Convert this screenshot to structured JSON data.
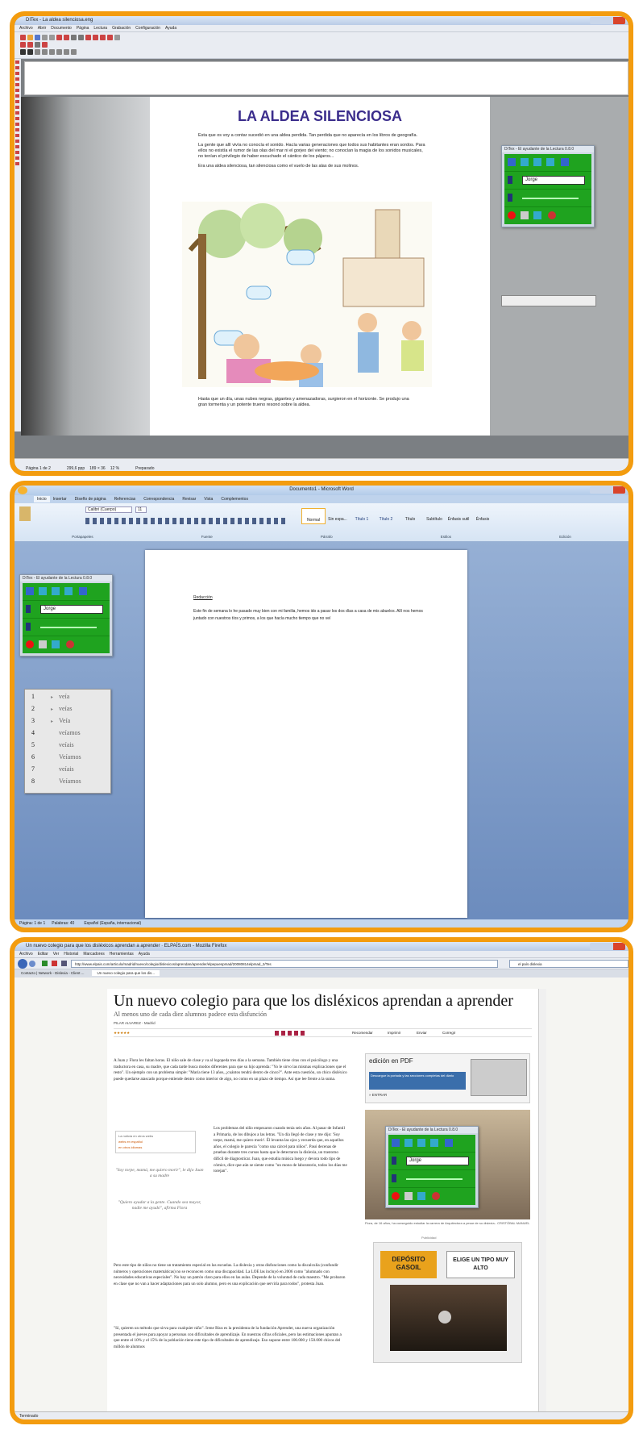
{
  "panel1": {
    "window_title": "DITex - La aldea silenciosa.eng",
    "menu": [
      "Archivo",
      "Abrir",
      "Documento",
      "Página",
      "Lectura",
      "Grabación",
      "Configuración",
      "Ayuda"
    ],
    "doc_title": "LA ALDEA SILENCIOSA",
    "doc_paragraphs": [
      "Esta que os voy a contar sucedió en una aldea perdida. Tan perdida que no aparecía en los libros de geografía.",
      "La gente que allí vivía no conocía el sonido. Hacía varias generaciones que todos sus habitantes eran sordos. Para ellos no existía el rumor de las olas del mar ni el gorjeo del viento; no conocían la magia de los sonidos musicales, no tenían el privilegio de haber escuchado el cántico de los pájaros...",
      "Era una aldea silenciosa, tan silenciosa como el vuelo de las alas de sus molinos."
    ],
    "doc_footer": "Hasta que un día, unas nubes negras, gigantes y amenazadoras, surgieron en el horizonte. Se produjo una gran tormenta y un potente trueno resonó sobre la aldea.",
    "status": [
      "Página 1 de 2",
      "299,6 ppp",
      "189 × 36",
      "12 %",
      "Preparado"
    ]
  },
  "reader": {
    "title": "DiTex - El ayudante de la Lectura 0.8.0",
    "voice": "Jorge"
  },
  "panel2": {
    "window_title": "Documento1 - Microsoft Word",
    "tabs": [
      "Inicio",
      "Insertar",
      "Diseño de página",
      "Referencias",
      "Correspondencia",
      "Revisar",
      "Vista",
      "Complementos"
    ],
    "font": "Calibri (Cuerpo)",
    "size": "11",
    "styles": [
      "Normal",
      "Sin espa...",
      "Título 1",
      "Título 2",
      "Título",
      "Subtítulo",
      "Énfasis sutil",
      "Énfasis"
    ],
    "groups": [
      "Portapapeles",
      "Fuente",
      "Párrafo",
      "Estilos",
      "Edición"
    ],
    "doc_heading": "Redacción",
    "doc_text": "Este fin de semana lo he pasado muy bien con mi familia, hemos ido a pasar los dos días a casa de mis abuelos. Allí nos hemos juntado con nuestros tíos y primos, a los que hacía mucho tiempo que no veí",
    "suggestions": [
      {
        "n": "1",
        "w": "veía"
      },
      {
        "n": "2",
        "w": "veías"
      },
      {
        "n": "3",
        "w": "Veía"
      },
      {
        "n": "4",
        "w": "veíamos"
      },
      {
        "n": "5",
        "w": "veíais"
      },
      {
        "n": "6",
        "w": "Veíamos"
      },
      {
        "n": "7",
        "w": "veíais"
      },
      {
        "n": "8",
        "w": "Veíamos"
      }
    ],
    "status": [
      "Página: 1 de 1",
      "Palabras: 40",
      "Español (España, internacional)"
    ]
  },
  "panel3": {
    "window_title": "Un nuevo colegio para que los disléxicos aprendan a aprender · ELPAÍS.com - Mozilla Firefox",
    "menu": [
      "Archivo",
      "Editar",
      "Ver",
      "Historial",
      "Marcadores",
      "Herramientas",
      "Ayuda"
    ],
    "url": "http://www.elpais.com/articulo/madrid/nuevo/colegio/dislexicos/aprendan/aprender/elpepuespmad/20080814elpmad_2/Tes",
    "search": "el país dislexia",
    "tabs": [
      "Contacto | Network - Dislexia - Client ...",
      "Un nuevo colegio para que los dis..."
    ],
    "headline": "Un nuevo colegio para que los disléxicos aprendan a aprender",
    "subhead": "Al menos uno de cada diez alumnos padece esta disfunción",
    "byline": "PILAR ALVAREZ - Madrid",
    "para1": "A Juan y Flora les faltan horas. El niño sale de clase y va al logopeda tres días a la semana. También tiene citas con el psicólogo y una traductora en casa, su madre, que cada tarde busca modos diferentes para que su hijo aprenda: \"Yo le sirvo las mismas explicaciones que el resto\". Un ejemplo con un problema simple: \"María tiene 13 años, ¿cuántos tendrá dentro de cinco?\". Ante esta cuestión, un chico disléxico puede quedarse atascado porque entiende dentro como interior de algo, no como en un plazo de tiempo. Así que lee frente a la suma.",
    "para2": "Los problemas del niño empezaron cuando tenía seis años. Al pasar de Infantil a Primaria, de los dibujos a las letras. \"Un día llegó de clase y me dijo: 'Soy torpe, mamá, me quiero morir'. Él levanta las ojos y recuerda que, en aquellos años, el colegio le parecía \"como una cárcel para niños\". Pasó decenas de pruebas durante tres cursos hasta que le detectaron la dislexia, un trastorno difícil de diagnosticar. Juan, que estudia música luego y devora todo tipo de cómics, dice que aún se siente como \"un mono de laboratorio, todos los días me torejan\".",
    "quote1": "\"Soy torpe, mamá, me quiero morir\", le dijo Juan a su madre",
    "quote2": "\"Quiero ayudar a la gente. Cuando sea mayor, nadie me ayudó\", afirma Flora",
    "side_box": [
      "La noticia en otros webs",
      "webs en español",
      "en otros idiomas"
    ],
    "para3": "Pero este tipo de niños no tiene un tratamiento especial en las escuelas. La dislexia y otras disfunciones como la discalculia (confundir números y operaciones matemáticas) no se reconocen como una discapacidad. La LOE las incluyó en 2006 como \"alumnado con necesidades educativas especiales\". No hay un patrón claro para ellos en las aulas. Depende de la voluntad de cada maestro. \"Me probaron en clase que no van a hacer adaptaciones para un solo alumno, pero es una explicación que serviría para todos\", protesta Juan.",
    "para4": "\"Sí, quieren un método que sirva para cualquier niño\". Irene Rius es la presidenta de la fundación Aprender, una nueva organización presentada el jueves para apoyar a personas con dificultades de aprendizaje. En nuestras cifras oficiales, pero las estimaciones apuntan a que entre el 10% y el 15% de la población tiene este tipo de dificultades de aprendizaje. Eso supone entre 100.000 y 150.000 chicos del millón de alumnos",
    "pdf_box": {
      "title": "edición en PDF",
      "text": "Descargue la portada y las secciones completas del diario",
      "link": "» ENTRAR"
    },
    "photo_caption": "Flora, de 16 años, ha conseguido estudiar la carrera de Arquitectura a pesar de su dislexia.- CRISTÓBAL MANUEL",
    "ad_label": "Publicidad",
    "ad_left": "DEPÓSITO GASOIL",
    "ad_right": "ELIGE UN TIPO MUY ALTO",
    "buttons": [
      "Recomendar",
      "Imprimir",
      "Enviar",
      "Corregir"
    ],
    "status": "Terminado"
  }
}
